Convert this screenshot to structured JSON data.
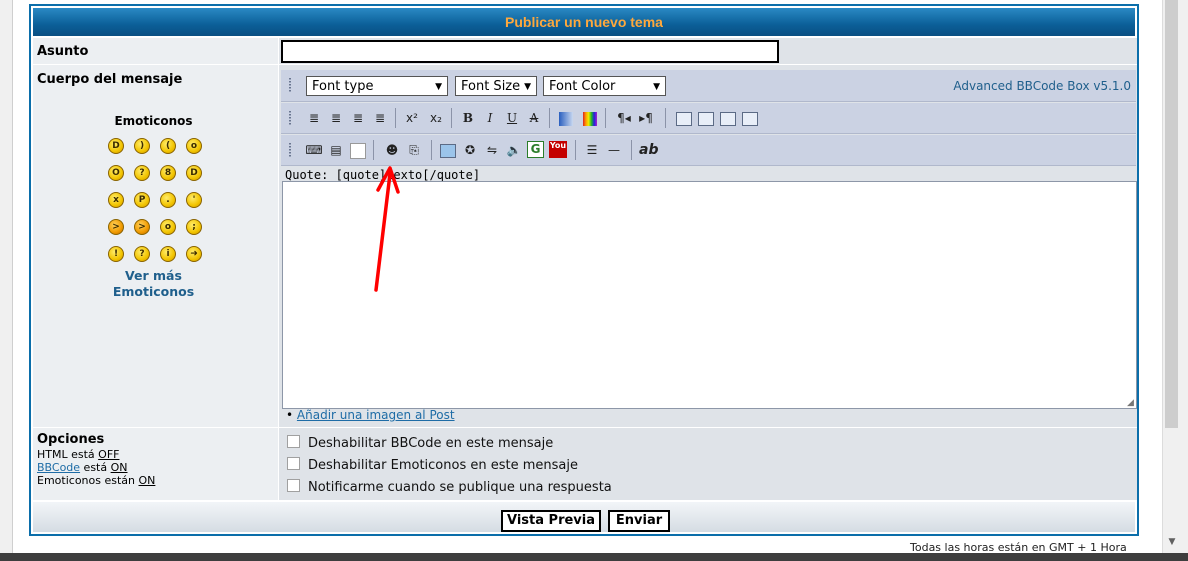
{
  "form": {
    "title": "Publicar un nuevo tema",
    "subject_label": "Asunto",
    "subject_value": "",
    "body_label": "Cuerpo del mensaje"
  },
  "emoticons": {
    "title": "Emoticonos",
    "rows": [
      [
        "very-happy-icon",
        "smile-icon",
        "sad-icon",
        "surprised-icon"
      ],
      [
        "shocked-icon",
        "confused-icon",
        "cool-icon",
        "laughing-icon"
      ],
      [
        "mad-icon",
        "razz-icon",
        "embarrassed-icon",
        "crying-icon"
      ],
      [
        "evil-icon",
        "twisted-evil-icon",
        "rolling-eyes-icon",
        "wink-icon"
      ],
      [
        "exclamation-icon",
        "question-icon",
        "idea-icon",
        "arrow-icon"
      ]
    ],
    "see_more_line1": "Ver más",
    "see_more_line2": "Emoticonos"
  },
  "bbcode": {
    "font_type": "Font type",
    "font_size": "Font Size",
    "font_color": "Font Color",
    "brand": "Advanced BBCode Box v5.1.0",
    "quote_help": "Quote: [quote]texto[/quote]",
    "add_image_link": "Añadir una imagen al Post",
    "bold_label": "B",
    "italic_label": "I",
    "underline_label": "U",
    "strike_label": "A",
    "rtl_label": "¶",
    "ltr_label": "¶",
    "ab_label": "ab",
    "google_label": "G",
    "youtube_label": "You"
  },
  "options": {
    "title": "Opciones",
    "html_prefix": "HTML está ",
    "html_state": "OFF",
    "bbcode_link": "BBCode",
    "bbcode_mid": " está ",
    "bbcode_state": "ON",
    "emoticons_prefix": "Emoticonos están ",
    "emoticons_state": "ON",
    "checkbox1": "Deshabilitar BBCode en este mensaje",
    "checkbox2": "Deshabilitar Emoticonos en este mensaje",
    "checkbox3": "Notificarme cuando se publique una respuesta"
  },
  "buttons": {
    "preview": "Vista Previa",
    "submit": "Enviar"
  },
  "footer": {
    "timezone": "Todas las horas están en GMT + 1 Hora"
  },
  "colors": {
    "title_bg": "#0b5f98",
    "title_text": "#ffa83c",
    "toolbar_bg": "#cbd2e3",
    "link": "#1e6ca6",
    "annotation_arrow": "#ff0000"
  }
}
